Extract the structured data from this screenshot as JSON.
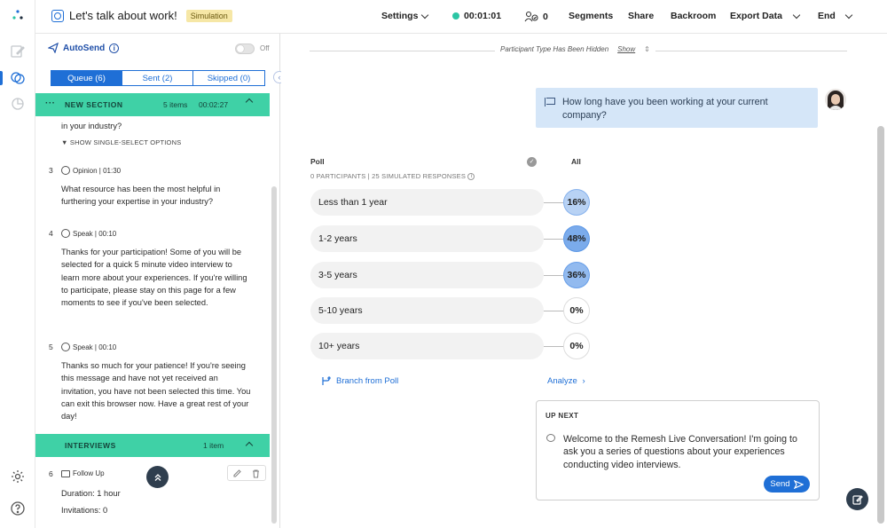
{
  "topbar": {
    "title": "Let's talk about work!",
    "badge": "Simulation",
    "settings": "Settings",
    "timer": "00:01:01",
    "participant_count": "0",
    "segments": "Segments",
    "share": "Share",
    "backroom": "Backroom",
    "export_data": "Export Data",
    "end": "End"
  },
  "panel": {
    "autosend": "AutoSend",
    "toggle_state": "Off",
    "tabs": [
      {
        "label": "Queue (6)"
      },
      {
        "label": "Sent (2)"
      },
      {
        "label": "Skipped (0)"
      }
    ],
    "section1": {
      "title": "NEW SECTION",
      "items": "5 items",
      "time": "00:02:27"
    },
    "partial_text": "in your industry?",
    "show_options": "▼ SHOW SINGLE-SELECT OPTIONS",
    "questions": [
      {
        "num": "3",
        "meta": "Opinion | 01:30",
        "text": "What resource has been the most helpful in furthering your expertise in your industry?"
      },
      {
        "num": "4",
        "meta": "Speak | 00:10",
        "text": "Thanks for your participation! Some of you will be selected for a quick 5 minute video interview to learn more about your experiences. If you're willing to participate, please stay on this page for a few moments to see if you've been selected."
      },
      {
        "num": "5",
        "meta": "Speak | 00:10",
        "text": "Thanks so much for your patience! If you're seeing this message and have not yet received an invitation, you have not been selected this time. You can exit this browser now. Have a great rest of your day!"
      }
    ],
    "section2": {
      "title": "INTERVIEWS",
      "items": "1 item"
    },
    "followup": {
      "num": "6",
      "meta": "Follow Up",
      "duration": "Duration: 1 hour",
      "invitations": "Invitations: 0"
    }
  },
  "main": {
    "hidden_notice": "Participant Type Has Been Hidden",
    "show_link": "Show",
    "question": "How long have you been working at your current company?",
    "poll": {
      "title": "Poll",
      "subtitle": "0 PARTICIPANTS | 25 SIMULATED RESPONSES",
      "column": "All",
      "options": [
        {
          "label": "Less than 1 year",
          "percent": "16%",
          "value": 16
        },
        {
          "label": "1-2 years",
          "percent": "48%",
          "value": 48
        },
        {
          "label": "3-5 years",
          "percent": "36%",
          "value": 36
        },
        {
          "label": "5-10 years",
          "percent": "0%",
          "value": 0
        },
        {
          "label": "10+ years",
          "percent": "0%",
          "value": 0
        }
      ]
    },
    "branch": "Branch from Poll",
    "analyze": "Analyze",
    "upnext": {
      "title": "UP NEXT",
      "text": "Welcome to the Remesh Live Conversation! I'm going to ask you a series of questions about your experiences conducting video interviews.",
      "send": "Send"
    }
  },
  "colors": {
    "accent": "#1f6fd6",
    "section": "#3fd1a6",
    "bubble": "#d5e6f8"
  }
}
